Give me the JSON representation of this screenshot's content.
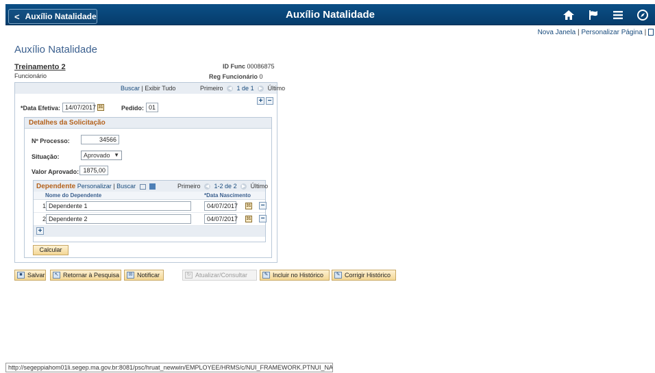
{
  "banner": {
    "back_label": "Auxílio Natalidade",
    "title": "Auxílio Natalidade",
    "icons": [
      "home-icon",
      "flag-icon",
      "menu-icon",
      "navbar-icon"
    ]
  },
  "toplinks": {
    "new_window": "Nova Janela",
    "separator": "|",
    "personalize": "Personalizar Página",
    "separator2": "|"
  },
  "page_title": "Auxílio Natalidade",
  "employee": {
    "name": "Treinamento 2",
    "role": "Funcionário",
    "id_label": "ID Func",
    "id_value": "00086875",
    "reg_label": "Reg Funcionário",
    "reg_value": "0"
  },
  "nav": {
    "search": "Buscar",
    "sep": "|",
    "view_all": "Exibir Tudo",
    "first": "Primeiro",
    "count": "1 de 1",
    "last": "Último"
  },
  "effective": {
    "date_label": "*Data Efetiva:",
    "date_value": "14/07/2017",
    "order_label": "Pedido:",
    "order_value": "01"
  },
  "details": {
    "header": "Detalhes da Solicitação",
    "process_label": "Nº Processo:",
    "process_value": "34566",
    "status_label": "Situação:",
    "status_value": "Aprovado",
    "amount_label": "Valor Aprovado:",
    "amount_value": "1875,00"
  },
  "dependents": {
    "title": "Dependente",
    "personalize": "Personalizar",
    "sep": "|",
    "search": "Buscar",
    "first": "Primeiro",
    "count": "1-2 de 2",
    "last": "Último",
    "col_name": "Nome do Dependente",
    "col_birth": "*Data Nascimento",
    "rows": [
      {
        "num": "1",
        "name": "Dependente 1",
        "birth": "04/07/2017"
      },
      {
        "num": "2",
        "name": "Dependente 2",
        "birth": "04/07/2017"
      }
    ],
    "calc_label": "Calcular"
  },
  "toolbar": {
    "save": "Salvar",
    "return": "Retornar à Pesquisa",
    "notify": "Notificar",
    "update": "Atualizar/Consultar",
    "include": "Incluir no Histórico",
    "correct": "Corrigir Histórico"
  },
  "status_url": "http://segeppiahom01li.segep.ma.gov.br:8081/psc/hruat_newwin/EMPLOYEE/HRMS/c/NUI_FRAMEWORK.PTNUI_NAVBAR...."
}
